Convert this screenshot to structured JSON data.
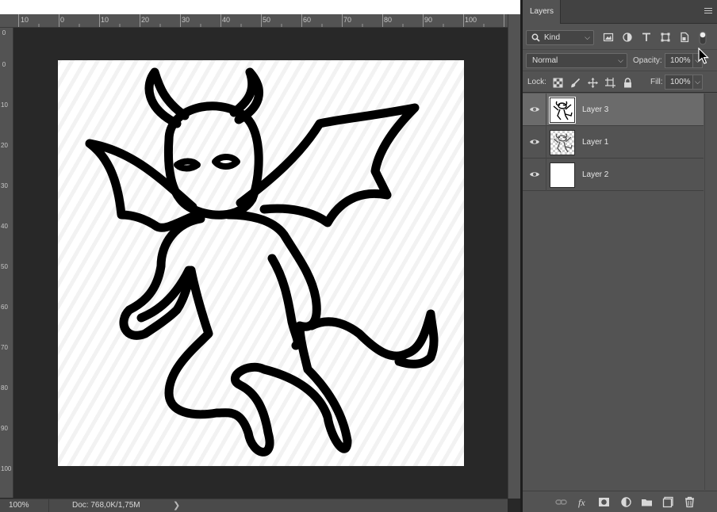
{
  "ruler": {
    "top_numbers": [
      "10",
      "0",
      "10",
      "20",
      "30",
      "40",
      "50",
      "60",
      "70",
      "80",
      "90",
      "100"
    ],
    "left_numbers": [
      "0",
      "0",
      "10",
      "20",
      "30",
      "40",
      "50",
      "60",
      "70",
      "80",
      "90",
      "100"
    ]
  },
  "status": {
    "zoom": "100%",
    "doc": "Doc: 768,0K/1,75M",
    "arrow": "❯"
  },
  "panel": {
    "tab": "Layers",
    "kind_label": "Kind",
    "blend_mode": "Normal",
    "opacity_label": "Opacity:",
    "opacity_value": "100%",
    "lock_label": "Lock:",
    "fill_label": "Fill:",
    "fill_value": "100%"
  },
  "layers": [
    {
      "name": "Layer 3",
      "selected": true
    },
    {
      "name": "Layer 1",
      "selected": false
    },
    {
      "name": "Layer 2",
      "selected": false
    }
  ],
  "icons": {
    "filter": [
      "image-filter-icon",
      "adjustment-filter-icon",
      "type-filter-icon",
      "shape-filter-icon",
      "smart-object-filter-icon"
    ],
    "lock": [
      "lock-transparent-icon",
      "lock-image-icon",
      "lock-position-icon",
      "lock-artboard-icon",
      "lock-all-icon"
    ],
    "footer": [
      "link-layers-icon",
      "fx-icon",
      "add-mask-icon",
      "adjustment-layer-icon",
      "new-group-icon",
      "new-layer-icon",
      "delete-layer-icon"
    ]
  },
  "colors": {
    "panel_bg": "#535353",
    "canvas_bg": "#282828",
    "selected_layer": "#6b6b6b"
  }
}
